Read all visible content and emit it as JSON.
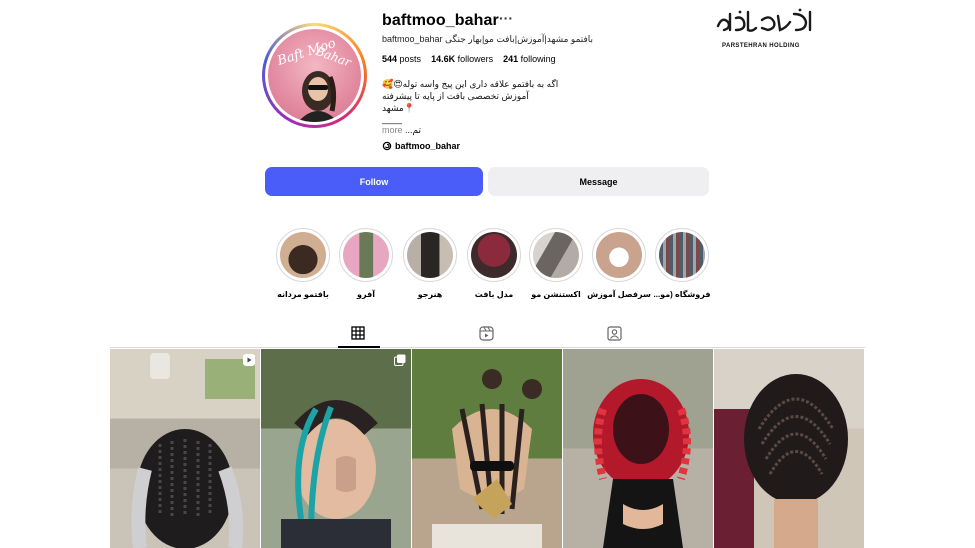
{
  "watermark": {
    "script": "پارس تهران",
    "sub": "PARSTEHRAN HOLDING"
  },
  "profile": {
    "avatar_text": "Baft Moo Bahar",
    "username": "baftmoo_bahar",
    "more": "···",
    "full_name": "baftmoo_bahar بافتمو مشهد|آموزش|بافت مو|بهار جنگی",
    "stats": {
      "posts_value": "544",
      "posts_label": "posts",
      "followers_value": "14.6K",
      "followers_label": "followers",
      "following_value": "241",
      "following_label": "following"
    },
    "bio": {
      "line1": "اگه به بافتمو علاقه داری این پیج واسه توله😍🥰",
      "line2": "آموزش تخصصی بافت از پایه تا پیشرفته",
      "line3": "📍مشهد",
      "dash": "____",
      "line4": "تم...",
      "more": "more"
    },
    "threads_handle": "baftmoo_bahar"
  },
  "buttons": {
    "follow": "Follow",
    "message": "Message"
  },
  "highlights": [
    {
      "label": "بافتمو مردانه",
      "color": "#b48a6a"
    },
    {
      "label": "آفرو",
      "color": "#c9a1b7"
    },
    {
      "label": "هنرجو",
      "color": "#8a8580"
    },
    {
      "label": "مدل بافت",
      "color": "#7a3e47"
    },
    {
      "label": "اکستنشن مو",
      "color": "#8f97a8"
    },
    {
      "label": "سرفصل آموزش",
      "color": "#d6c2ba"
    },
    {
      "label": "فروشگاه (مو...",
      "color": "#6c7a86"
    }
  ],
  "tabs": [
    {
      "name": "posts-tab",
      "icon": "grid-icon",
      "active": true
    },
    {
      "name": "reels-tab",
      "icon": "reels-icon",
      "active": false
    },
    {
      "name": "tagged-tab",
      "icon": "tagged-icon",
      "active": false
    }
  ],
  "posts": [
    {
      "badge": "reel-icon"
    },
    {
      "badge": "carousel-icon"
    },
    {
      "badge": ""
    },
    {
      "badge": ""
    },
    {
      "badge": ""
    }
  ],
  "colors": {
    "follow_button": "#4a5df9",
    "message_button": "#efeff1"
  }
}
